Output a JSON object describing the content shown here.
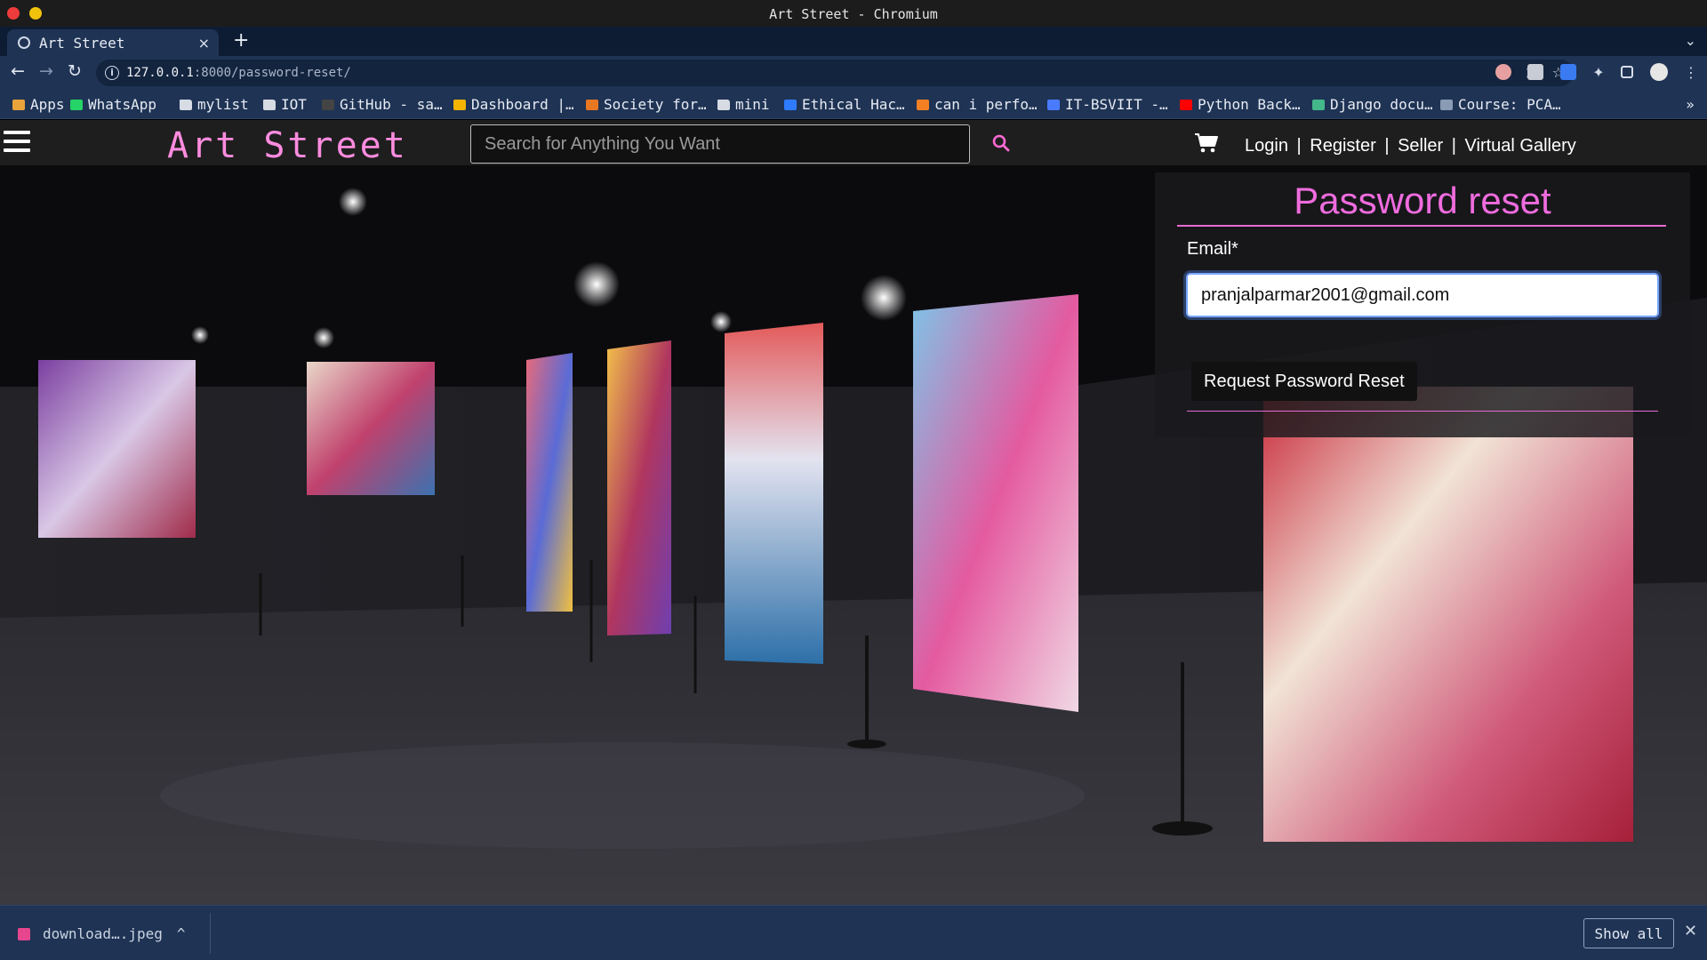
{
  "window": {
    "title": "Art Street - Chromium"
  },
  "tabs": [
    {
      "label": "Art Street",
      "close": "×"
    }
  ],
  "browser": {
    "new_tab": "+",
    "tab_menu": "⌄",
    "back": "←",
    "forward": "→",
    "reload": "↻",
    "url_host": "127.0.0.1",
    "url_path": ":8000/password-reset/",
    "zoom_icon": "⌕",
    "send_icon": "➤",
    "star_icon": "☆",
    "more": "⋮"
  },
  "bookmarks": {
    "items": [
      {
        "label": "Apps",
        "icon": "apps-grid-icon",
        "color": "#e8a33b"
      },
      {
        "label": "WhatsApp",
        "icon": "whatsapp-icon",
        "color": "#25d366"
      },
      {
        "label": "mylist",
        "icon": "folder-icon",
        "color": "#d6dbe4"
      },
      {
        "label": "IOT",
        "icon": "folder-icon",
        "color": "#d6dbe4"
      },
      {
        "label": "GitHub - sa…",
        "icon": "github-icon",
        "color": "#444444"
      },
      {
        "label": "Dashboard |…",
        "icon": "dashboard-icon",
        "color": "#f4b400"
      },
      {
        "label": "Society for…",
        "icon": "in-icon",
        "color": "#e87722"
      },
      {
        "label": "mini",
        "icon": "folder-icon",
        "color": "#d6dbe4"
      },
      {
        "label": "Ethical Hac…",
        "icon": "s-logo-icon",
        "color": "#2f7bff"
      },
      {
        "label": "can i perfo…",
        "icon": "stackoverflow-icon",
        "color": "#f48024"
      },
      {
        "label": "IT-BSVIIT -…",
        "icon": "people-icon",
        "color": "#4a7bff"
      },
      {
        "label": "Python Back…",
        "icon": "youtube-icon",
        "color": "#ff0000"
      },
      {
        "label": "Django docu…",
        "icon": "django-icon",
        "color": "#44b78b"
      },
      {
        "label": "Course: PCA…",
        "icon": "course-icon",
        "color": "#8a9bb5"
      }
    ],
    "more": "»"
  },
  "site": {
    "brand": "Art Street",
    "search_placeholder": "Search for Anything You Want",
    "nav": {
      "login": "Login",
      "register": "Register",
      "seller": "Seller",
      "virtual_gallery": "Virtual Gallery",
      "separator": "|"
    }
  },
  "form": {
    "title": "Password reset",
    "email_label": "Email*",
    "email_value": "pranjalparmar2001@gmail.com",
    "submit": "Request Password Reset"
  },
  "downloads": {
    "file": "download….jpeg",
    "caret": "^",
    "show_all": "Show all",
    "close": "✕"
  },
  "colors": {
    "brand_pink": "#ff8cdf",
    "heading_pink": "#ef6cde",
    "browser_chrome": "#1f3354"
  }
}
